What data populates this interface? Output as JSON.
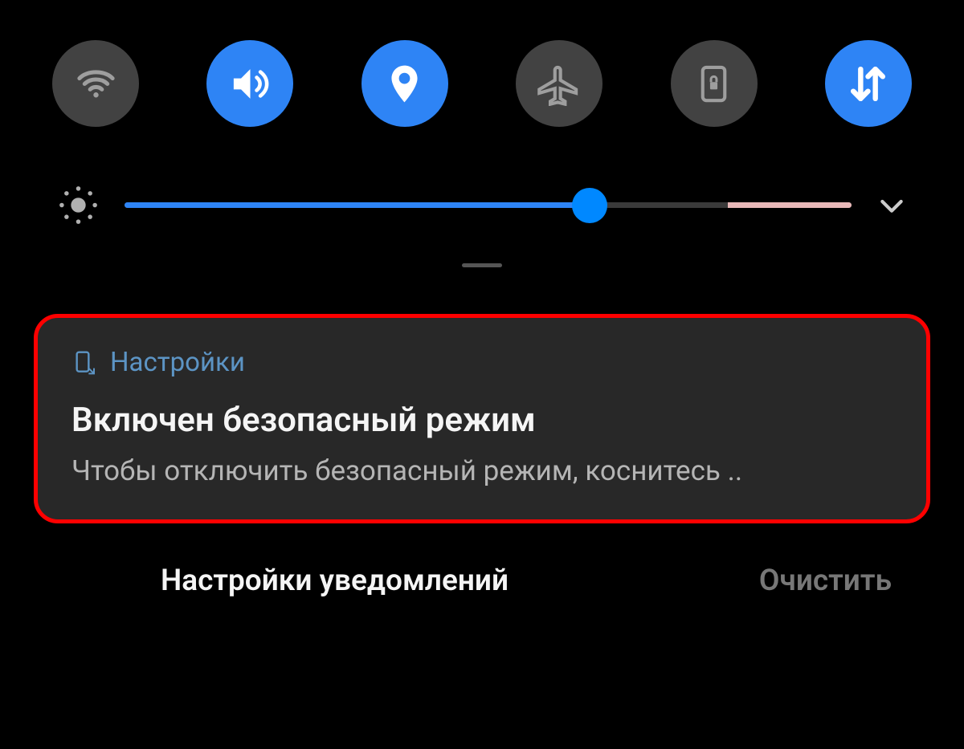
{
  "toggles": [
    {
      "name": "wifi",
      "active": false
    },
    {
      "name": "sound",
      "active": true
    },
    {
      "name": "location",
      "active": true
    },
    {
      "name": "airplane",
      "active": false
    },
    {
      "name": "rotation-lock",
      "active": false
    },
    {
      "name": "mobile-data",
      "active": true
    }
  ],
  "brightness": {
    "value": 64,
    "auto_end": 83
  },
  "notification": {
    "app_name": "Настройки",
    "title": "Включен безопасный режим",
    "body": "Чтобы отключить безопасный режим, коснитесь .."
  },
  "footer": {
    "settings_label": "Настройки уведомлений",
    "clear_label": "Очистить"
  },
  "colors": {
    "accent": "#2e84f5",
    "highlight": "#ff0000"
  }
}
